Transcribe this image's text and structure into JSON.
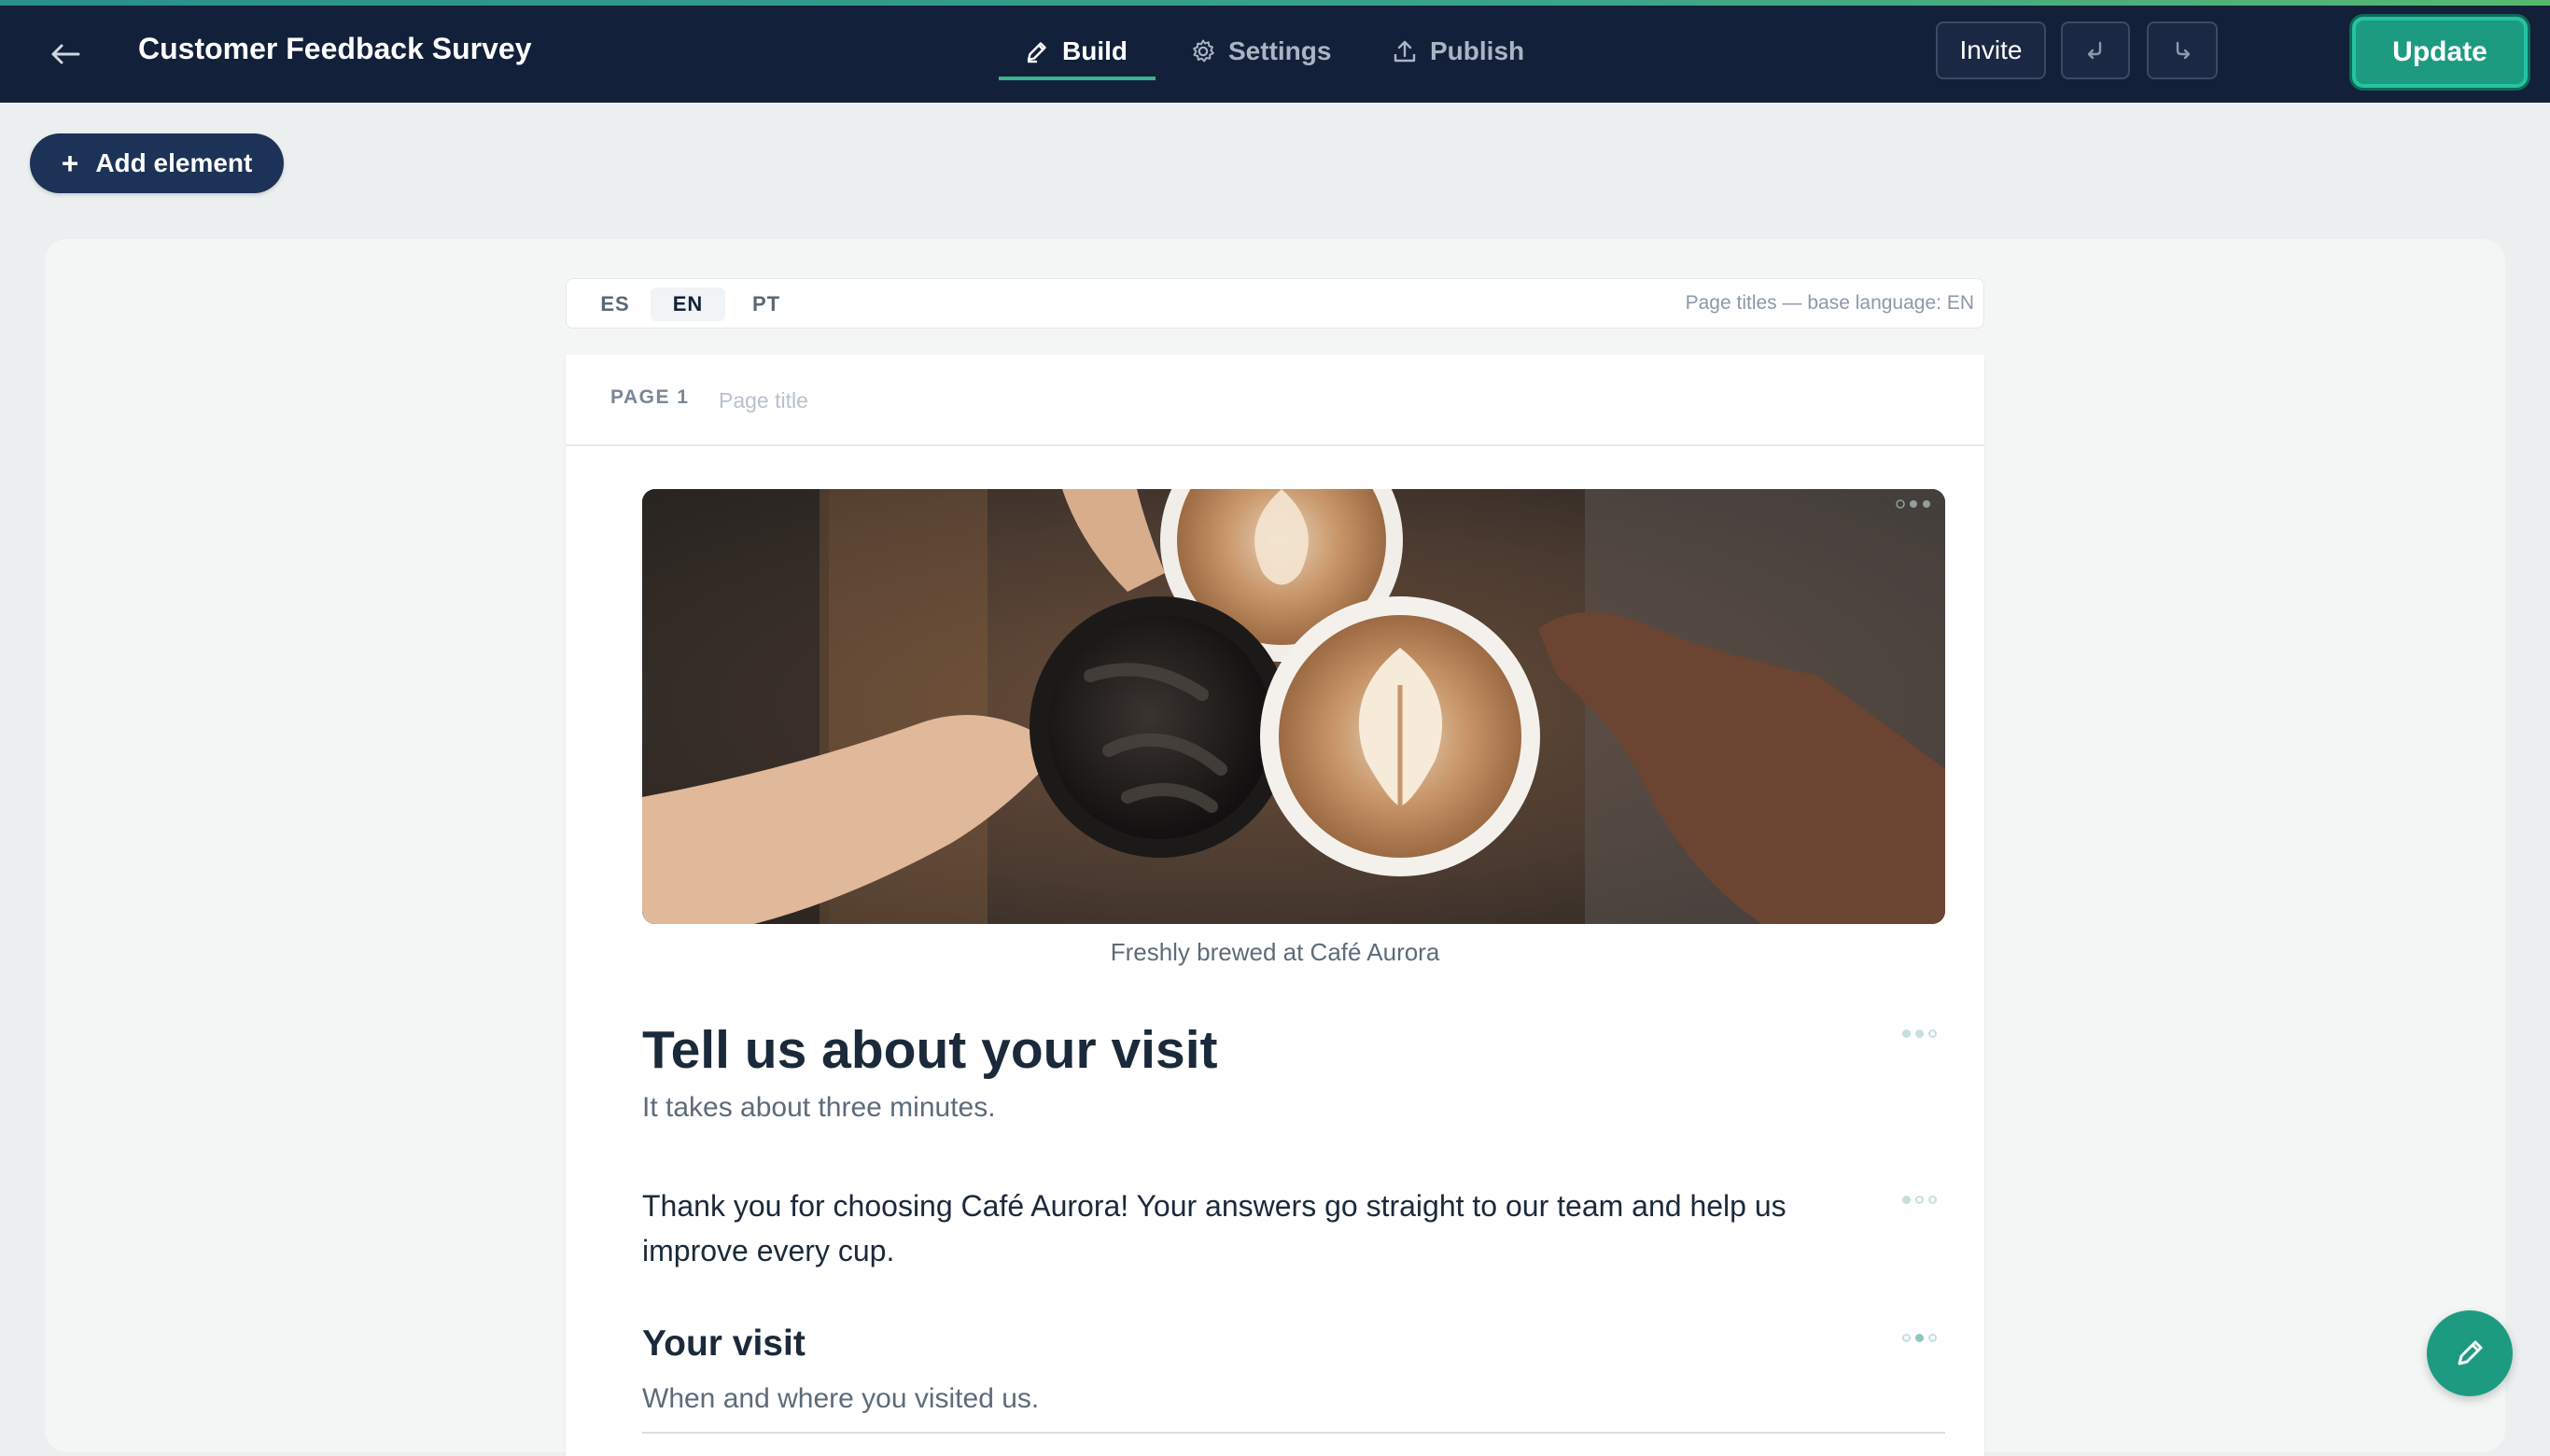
{
  "header": {
    "back_icon": "arrow-left-icon",
    "title": "Customer Feedback Survey",
    "tabs": [
      {
        "label": "Build",
        "icon": "pencil-icon",
        "active": true
      },
      {
        "label": "Settings",
        "icon": "gear-icon",
        "active": false
      },
      {
        "label": "Publish",
        "icon": "upload-icon",
        "active": false
      }
    ],
    "invite_label": "Invite",
    "undo_icon": "undo-icon",
    "redo_icon": "redo-icon",
    "update_label": "Update"
  },
  "toolbar": {
    "add_element_label": "Add element",
    "add_element_icon": "plus-icon"
  },
  "languages": {
    "options": [
      "ES",
      "EN",
      "PT"
    ],
    "selected": "EN",
    "note": "Page titles — base language: EN"
  },
  "page": {
    "label": "PAGE 1",
    "title_placeholder": "Page title",
    "title_value": "",
    "image_caption": "Freshly brewed at Café Aurora",
    "heading": "Tell us about your visit",
    "subheading": "It takes about three minutes.",
    "intro_text": "Thank you for choosing Café Aurora! Your answers go straight to our team and help us improve every cup.",
    "section": {
      "title": "Your visit",
      "subtitle": "When and where you visited us."
    }
  },
  "fab": {
    "icon": "pencil-icon"
  },
  "colors": {
    "topbar": "#13203a",
    "accent": "#1d9b80",
    "add_button": "#1c3257",
    "canvas": "#f4f6f6"
  }
}
